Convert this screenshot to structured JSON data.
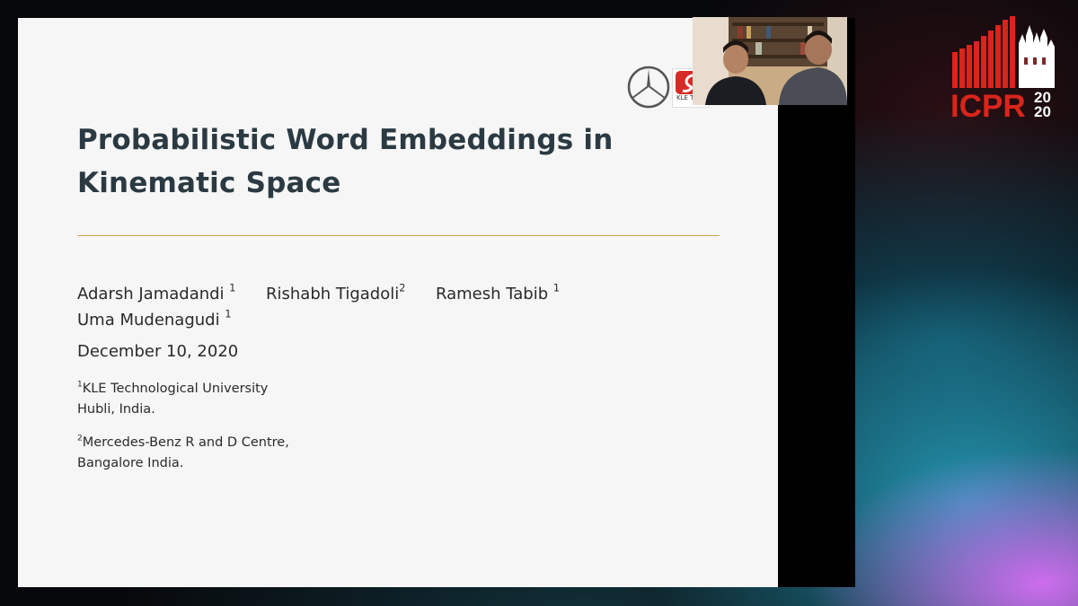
{
  "slide": {
    "title": "Probabilistic Word Embeddings in Kinematic Space",
    "authors": [
      {
        "name": "Adarsh Jamadandi",
        "sup": "1"
      },
      {
        "name": "Rishabh Tigadoli",
        "sup": "2"
      },
      {
        "name": "Ramesh Tabib",
        "sup": "1"
      },
      {
        "name": "Uma Mudenagudi",
        "sup": "1"
      }
    ],
    "date": "December 10, 2020",
    "affiliations": [
      {
        "sup": "1",
        "line1": "KLE Technological University",
        "line2": "Hubli, India."
      },
      {
        "sup": "2",
        "line1": "Mercedes-Benz R and D Centre,",
        "line2": "Bangalore India."
      }
    ],
    "logos": {
      "benz": "mercedes-benz-star-logo",
      "kle": {
        "icon": "kle-logo",
        "label": "KLE T"
      }
    }
  },
  "webcam": {
    "icon": "webcam-video-presenters"
  },
  "conference_logo": {
    "text": "ICPR",
    "year_top": "20",
    "year_bottom": "20",
    "icon": "icpr-cathedral-logo"
  },
  "colors": {
    "slide_bg": "#f6f6f6",
    "title": "#2b3a42",
    "rule": "#d6a04c",
    "icpr_red": "#d9251c",
    "kle_red": "#d52a25"
  }
}
